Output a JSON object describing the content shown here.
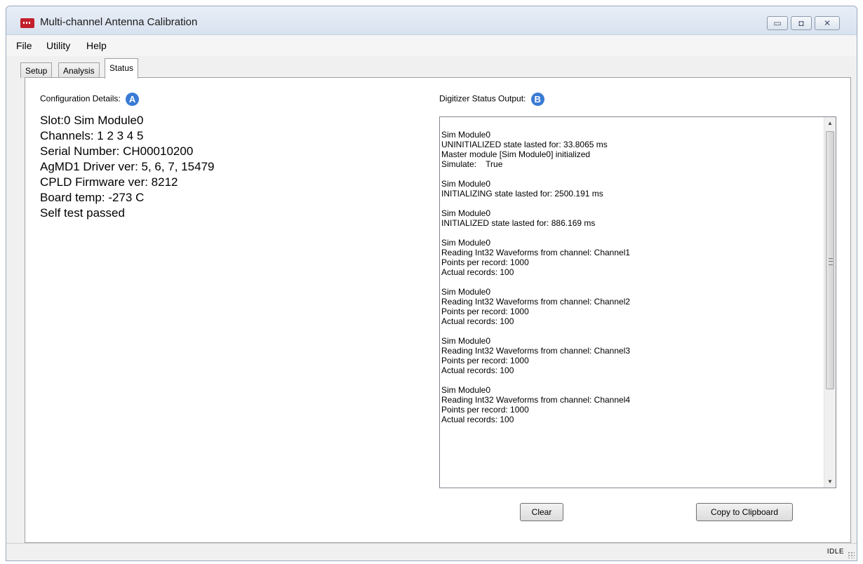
{
  "window": {
    "title": "Multi-channel Antenna Calibration",
    "icon": "app-logo-icon",
    "controls": {
      "minimize": "▭",
      "maximize": "◘",
      "close": "✕"
    }
  },
  "menu": {
    "items": [
      "File",
      "Utility",
      "Help"
    ]
  },
  "tabs": [
    {
      "label": "Setup",
      "active": false
    },
    {
      "label": "Analysis",
      "active": false
    },
    {
      "label": "Status",
      "active": true
    }
  ],
  "config": {
    "label": "Configuration Details:",
    "badge": "A",
    "lines": [
      "Slot:0   Sim Module0",
      "Channels: 1 2 3 4 5",
      "Serial Number: CH00010200",
      "AgMD1 Driver ver: 5, 6, 7, 15479",
      "CPLD Firmware ver: 8212",
      "Board temp: -273 C",
      "Self test passed"
    ]
  },
  "digitizer": {
    "label": "Digitizer Status Output:",
    "badge": "B",
    "blocks": [
      [
        "Sim Module0",
        "UNINITIALIZED state lasted for: 33.8065 ms",
        "Master module [Sim Module0] initialized",
        "Simulate:    True"
      ],
      [
        "Sim Module0",
        "INITIALIZING state lasted for: 2500.191 ms"
      ],
      [
        "Sim Module0",
        "INITIALIZED state lasted for: 886.169 ms"
      ],
      [
        "Sim Module0",
        "Reading Int32 Waveforms from channel: Channel1",
        "Points per record: 1000",
        "Actual records: 100"
      ],
      [
        "Sim Module0",
        "Reading Int32 Waveforms from channel: Channel2",
        "Points per record: 1000",
        "Actual records: 100"
      ],
      [
        "Sim Module0",
        "Reading Int32 Waveforms from channel: Channel3",
        "Points per record: 1000",
        "Actual records: 100"
      ],
      [
        "Sim Module0",
        "Reading Int32 Waveforms from channel: Channel4",
        "Points per record: 1000",
        "Actual records: 100"
      ]
    ],
    "scroll": {
      "up": "▲",
      "down": "▼"
    }
  },
  "buttons": {
    "clear": "Clear",
    "copy": "Copy to Clipboard"
  },
  "status": {
    "text": "IDLE"
  },
  "colors": {
    "badge": "#3a7bd5",
    "app_icon": "#c21f2b"
  }
}
